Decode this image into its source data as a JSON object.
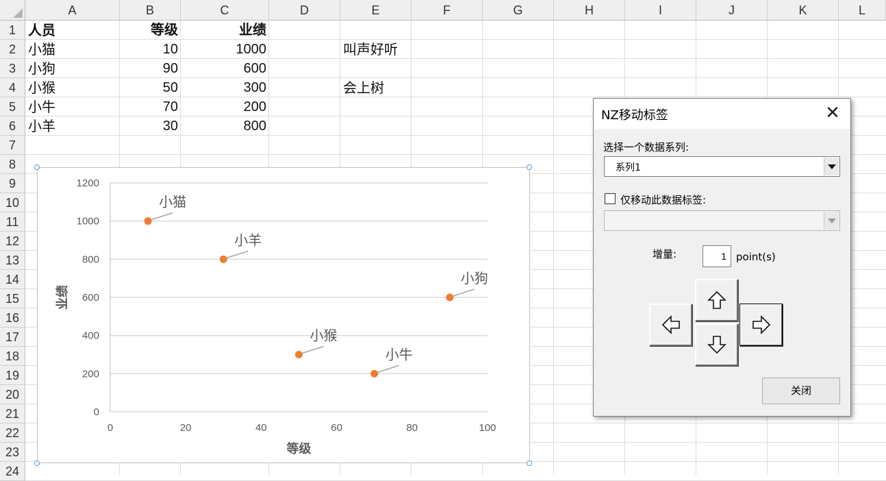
{
  "columns": [
    "A",
    "B",
    "C",
    "D",
    "E",
    "F",
    "G",
    "H",
    "I",
    "J",
    "K",
    "L"
  ],
  "rows": [
    "1",
    "2",
    "3",
    "4",
    "5",
    "6",
    "7",
    "8",
    "9",
    "10",
    "11",
    "12",
    "13",
    "14",
    "15",
    "16",
    "17",
    "18",
    "19",
    "20",
    "21",
    "22",
    "23",
    "24"
  ],
  "table": {
    "headers": [
      "人员",
      "等级",
      "业绩"
    ],
    "data": [
      [
        "小猫",
        "10",
        "1000"
      ],
      [
        "小狗",
        "90",
        "600"
      ],
      [
        "小猴",
        "50",
        "300"
      ],
      [
        "小牛",
        "70",
        "200"
      ],
      [
        "小羊",
        "30",
        "800"
      ]
    ]
  },
  "notes": {
    "e2": "叫声好听",
    "e4": "会上树"
  },
  "chart_data": {
    "type": "scatter",
    "xlabel": "等级",
    "ylabel": "业绩",
    "xlim": [
      0,
      100
    ],
    "ylim": [
      0,
      1200
    ],
    "x_ticks": [
      "0",
      "20",
      "40",
      "60",
      "80",
      "100"
    ],
    "y_ticks": [
      "0",
      "200",
      "400",
      "600",
      "800",
      "1000",
      "1200"
    ],
    "grid": true,
    "marker_color": "#ED7D31",
    "series": [
      {
        "points": [
          {
            "label": "小猫",
            "x": 10,
            "y": 1000
          },
          {
            "label": "小狗",
            "x": 90,
            "y": 600
          },
          {
            "label": "小猴",
            "x": 50,
            "y": 300
          },
          {
            "label": "小牛",
            "x": 70,
            "y": 200
          },
          {
            "label": "小羊",
            "x": 30,
            "y": 800
          }
        ]
      }
    ]
  },
  "dialog": {
    "title": "NZ移动标签",
    "series_label": "选择一个数据系列:",
    "series_value": "系列1",
    "only_label_text": "仅移动此数据标签:",
    "only_label_checked": false,
    "increment_label": "增量:",
    "increment_value": "1",
    "increment_unit": "point(s)",
    "close_label": "关闭",
    "icons": [
      "close-icon",
      "arrow-up-icon",
      "arrow-left-icon",
      "arrow-right-icon",
      "arrow-down-icon"
    ]
  }
}
